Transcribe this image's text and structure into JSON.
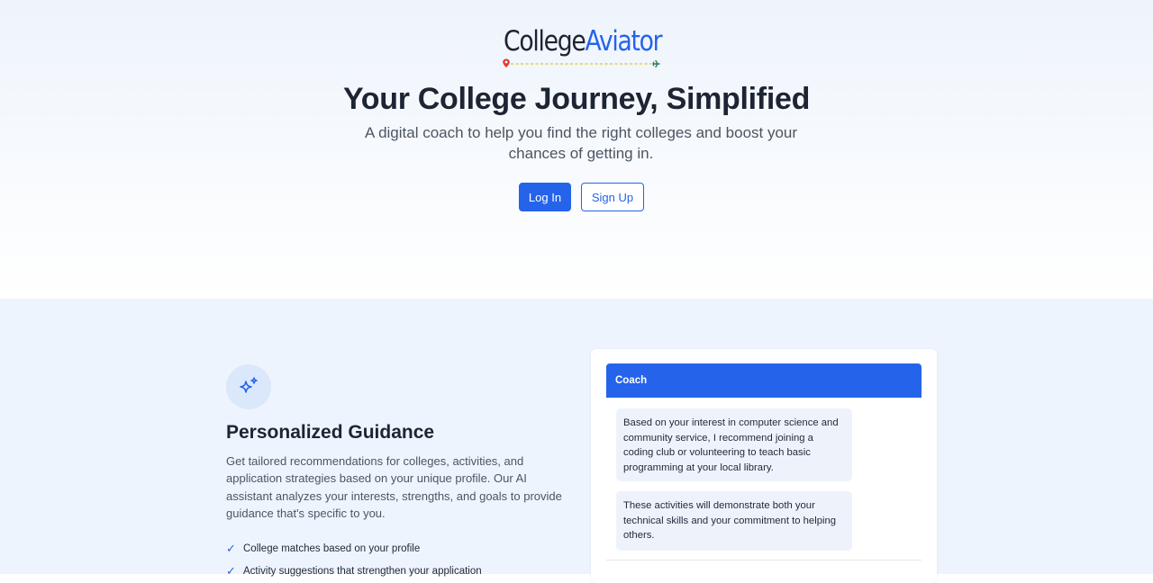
{
  "brand": {
    "name_part1": "College",
    "name_part2": "Aviator",
    "primary_color": "#2563eb",
    "dark_color": "#1f2433"
  },
  "hero": {
    "title": "Your College Journey, Simplified",
    "subtitle": "A digital coach to help you find the right colleges and boost your chances of getting in.",
    "login_label": "Log In",
    "signup_label": "Sign Up"
  },
  "feature": {
    "icon": "sparkles-icon",
    "title": "Personalized Guidance",
    "description": "Get tailored recommendations for colleges, activities, and application strategies based on your unique profile. Our AI assistant analyzes your interests, strengths, and goals to provide guidance that's specific to you.",
    "checklist": [
      "College matches based on your profile",
      "Activity suggestions that strengthen your application"
    ]
  },
  "chat": {
    "header": "Coach",
    "messages": [
      "Based on your interest in computer science and community service, I recommend joining a coding club or volunteering to teach basic programming at your local library.",
      "These activities will demonstrate both your technical skills and your commitment to helping others."
    ]
  }
}
